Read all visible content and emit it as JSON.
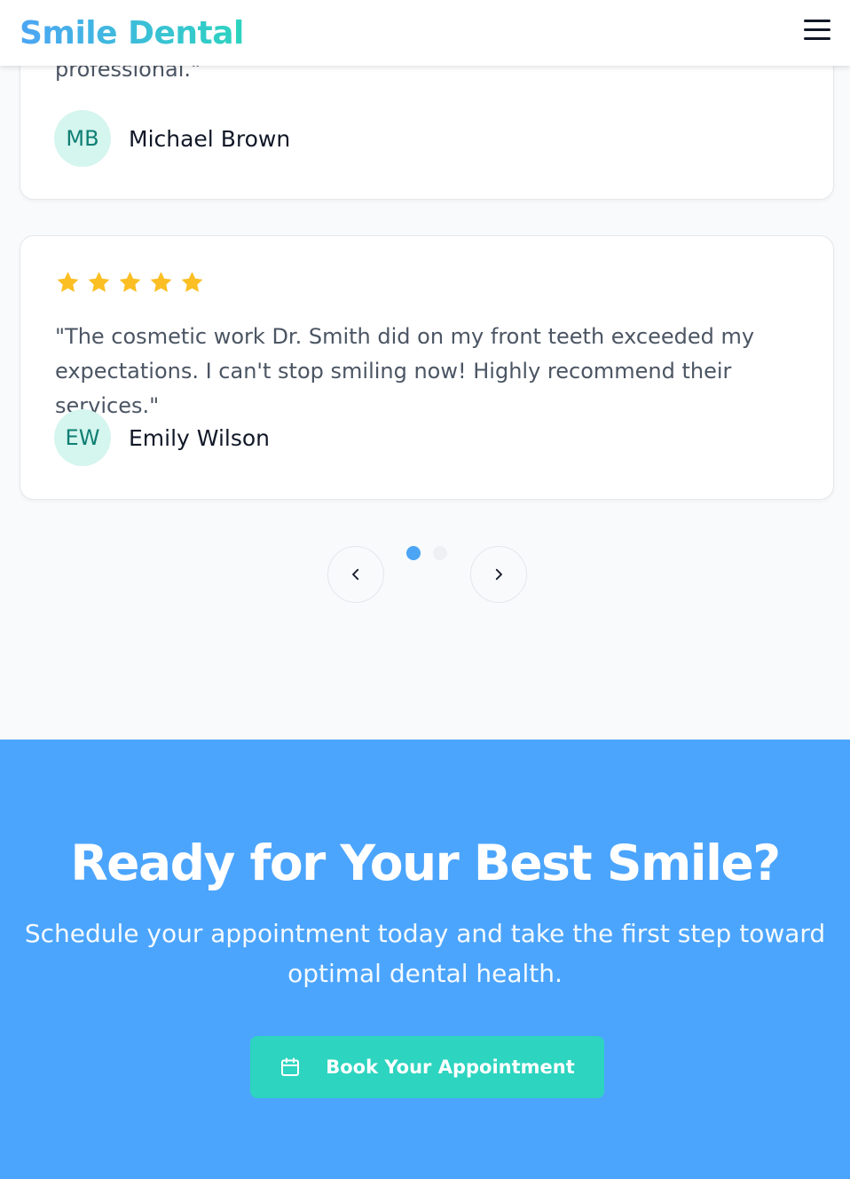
{
  "header": {
    "logo": "Smile Dental",
    "menu_icon": "hamburger-menu-icon"
  },
  "testimonials": [
    {
      "quote": "professional.\"",
      "initials": "MB",
      "name": "Michael Brown"
    },
    {
      "rating": 5,
      "quote": "\"The cosmetic work Dr. Smith did on my front teeth exceeded my expectations. I can't stop smiling now! Highly recommend their services.\"",
      "initials": "EW",
      "name": "Emily Wilson"
    }
  ],
  "carousel": {
    "prev_icon": "chevron-left-icon",
    "next_icon": "chevron-right-icon",
    "dots": 2,
    "active_dot": 1
  },
  "cta": {
    "title": "Ready for Your Best Smile?",
    "subtitle": "Schedule your appointment today and take the first step toward optimal dental health.",
    "button_label": "Book Your Appointment",
    "button_icon": "calendar-icon"
  },
  "colors": {
    "brand_blue": "#4ca5f4",
    "brand_teal": "#2dd4bf",
    "cta_background": "#4ca5fd",
    "star": "#fbbf24",
    "avatar_bg": "#d5f5ef",
    "avatar_text": "#0f7f73"
  }
}
